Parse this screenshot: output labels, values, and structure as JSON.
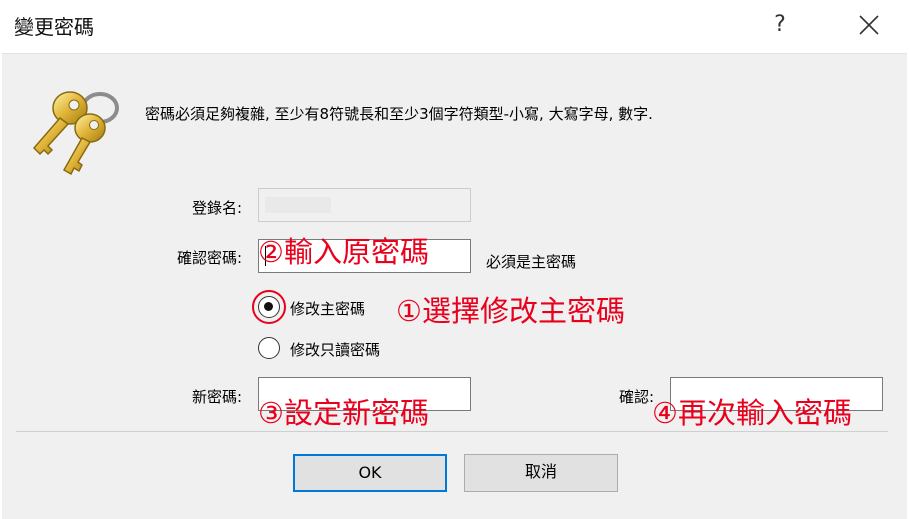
{
  "window": {
    "title": "變更密碼",
    "help_label": "?"
  },
  "info": {
    "text": "密碼必須足夠複雜, 至少有8符號長和至少3個字符類型-小寫, 大寫字母, 數字."
  },
  "form": {
    "login_label": "登錄名:",
    "login_value": "",
    "confirm_label": "確認密碼:",
    "confirm_hint": "必須是主密碼",
    "new_password_label": "新密碼:",
    "confirm2_label": "確認:"
  },
  "options": [
    {
      "label": "修改主密碼",
      "selected": true
    },
    {
      "label": "修改只讀密碼",
      "selected": false
    }
  ],
  "annotations": {
    "step1": "①選擇修改主密碼",
    "step2": "②輸入原密碼",
    "step3": "③設定新密碼",
    "step4": "④再次輸入密碼"
  },
  "buttons": {
    "ok": "OK",
    "cancel": "取消"
  },
  "colors": {
    "annotation": "#e8001c",
    "default_button_border": "#0078d7",
    "dialog_background": "#f0f0f0"
  },
  "icons": {
    "dialog_icon": "keys-icon",
    "close": "close-icon"
  }
}
